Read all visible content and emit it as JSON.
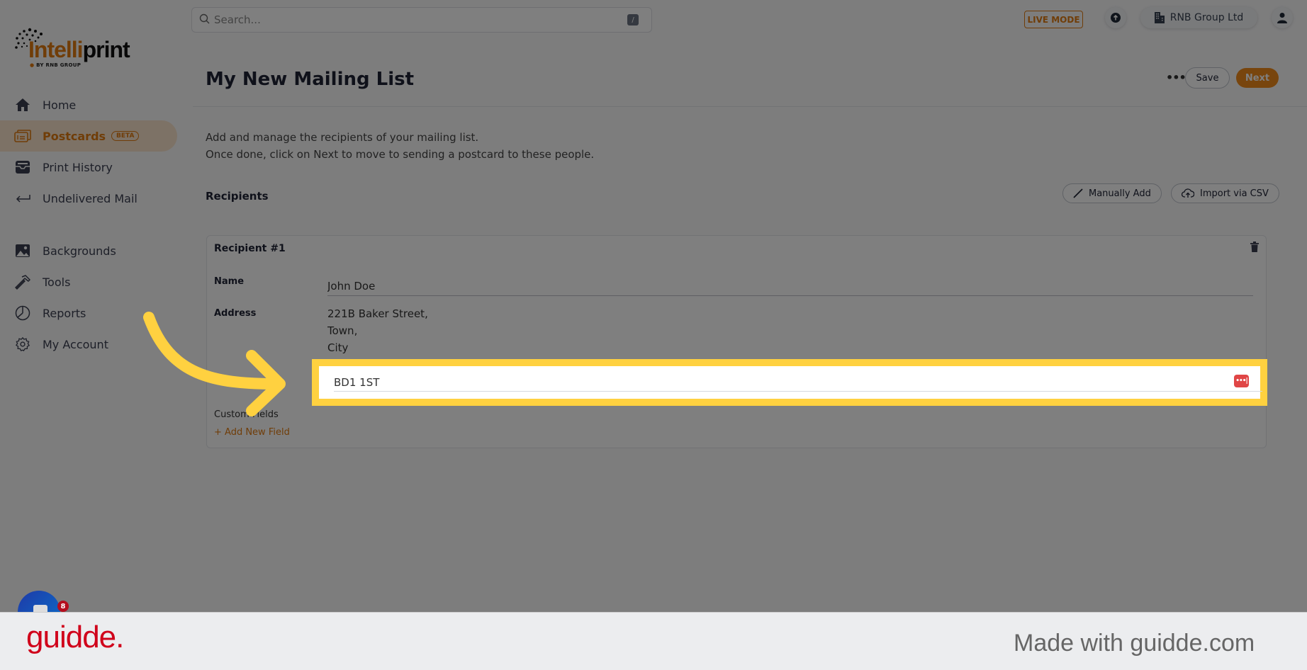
{
  "brand": {
    "name_part1": "Intelli",
    "name_part2": "print",
    "tagline": "BY RNB GROUP",
    "accent": "#e07b10"
  },
  "sidebar": {
    "items": [
      {
        "label": "Home",
        "icon": "home-icon"
      },
      {
        "label": "Postcards",
        "icon": "postcard-icon",
        "badge": "BETA",
        "active": true
      },
      {
        "label": "Print History",
        "icon": "inbox-tray-icon"
      },
      {
        "label": "Undelivered Mail",
        "icon": "return-arrow-icon"
      },
      {
        "label": "Backgrounds",
        "icon": "image-icon"
      },
      {
        "label": "Tools",
        "icon": "hammer-icon"
      },
      {
        "label": "Reports",
        "icon": "pie-chart-icon"
      },
      {
        "label": "My Account",
        "icon": "gear-icon"
      }
    ]
  },
  "topbar": {
    "search_placeholder": "Search...",
    "search_shortcut": "/",
    "mode_badge": "LIVE MODE",
    "org_name": "RNB Group Ltd"
  },
  "header": {
    "title": "My New Mailing List",
    "more_label": "•••",
    "save_label": "Save",
    "next_label": "Next"
  },
  "description": {
    "line1": "Add and manage the recipients of your mailing list.",
    "line2": "Once done, click on Next to move to sending a postcard to these people."
  },
  "recipients": {
    "section_title": "Recipients",
    "manual_add_label": "Manually Add",
    "import_label": "Import via CSV",
    "cards": [
      {
        "title": "Recipient #1",
        "name_label": "Name",
        "name_value": "John Doe",
        "address_label": "Address",
        "address_value": "221B Baker Street,\nTown,\nCity",
        "postcode_value": "BD1 1ST",
        "custom_fields_label": "Custom Fields",
        "add_field_label": "+ Add New Field"
      }
    ]
  },
  "chat": {
    "badge_count": "8"
  },
  "footer": {
    "logo": "guidde.",
    "tagline": "Made with guidde.com"
  }
}
